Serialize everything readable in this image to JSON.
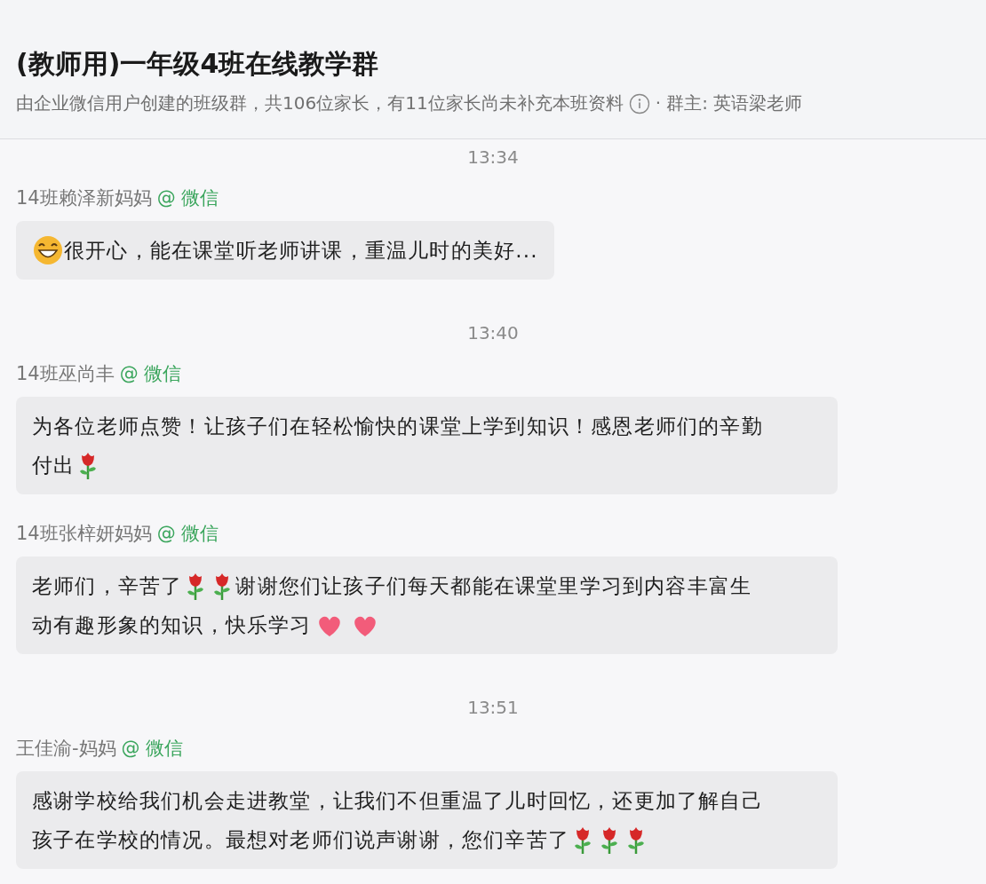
{
  "header": {
    "title": "(教师用)一年级4班在线教学群",
    "subtitle": "由企业微信用户创建的班级群，共106位家长，有11位家长尚未补充本班资料",
    "owner": "· 群主: 英语梁老师"
  },
  "blocks": [
    {
      "kind": "time",
      "time": "13:34"
    },
    {
      "kind": "message",
      "sender": "14班赖泽新妈妈",
      "source": "@ 微信",
      "lines": [
        [
          {
            "kind": "grin"
          },
          {
            "kind": "text",
            "text": "很开心，能在课堂听老师讲课，重温儿时的美好..."
          }
        ]
      ]
    },
    {
      "kind": "time",
      "time": "13:40"
    },
    {
      "kind": "message",
      "sender": "14班巫尚丰",
      "source": "@ 微信",
      "lines": [
        [
          {
            "kind": "text",
            "text": "为各位老师点赞！让孩子们在轻松愉快的课堂上学到知识！感恩老师们的辛勤"
          }
        ],
        [
          {
            "kind": "text",
            "text": "付出"
          },
          {
            "kind": "rose"
          }
        ]
      ]
    },
    {
      "kind": "message",
      "sender": "14班张梓妍妈妈",
      "source": "@ 微信",
      "lines": [
        [
          {
            "kind": "text",
            "text": "老师们，辛苦了"
          },
          {
            "kind": "rose"
          },
          {
            "kind": "rose"
          },
          {
            "kind": "text",
            "text": "谢谢您们让孩子们每天都能在课堂里学习到内容丰富生"
          }
        ],
        [
          {
            "kind": "text",
            "text": "动有趣形象的知识，快乐学习"
          },
          {
            "kind": "heart"
          },
          {
            "kind": "heart"
          }
        ]
      ]
    },
    {
      "kind": "time",
      "time": "13:51"
    },
    {
      "kind": "message",
      "sender": "王佳渝-妈妈",
      "source": "@ 微信",
      "lines": [
        [
          {
            "kind": "text",
            "text": "感谢学校给我们机会走进教堂，让我们不但重温了儿时回忆，还更加了解自己"
          }
        ],
        [
          {
            "kind": "text",
            "text": "孩子在学校的情况。最想对老师们说声谢谢，您们辛苦了"
          },
          {
            "kind": "rose"
          },
          {
            "kind": "rose"
          },
          {
            "kind": "rose"
          }
        ]
      ]
    }
  ]
}
